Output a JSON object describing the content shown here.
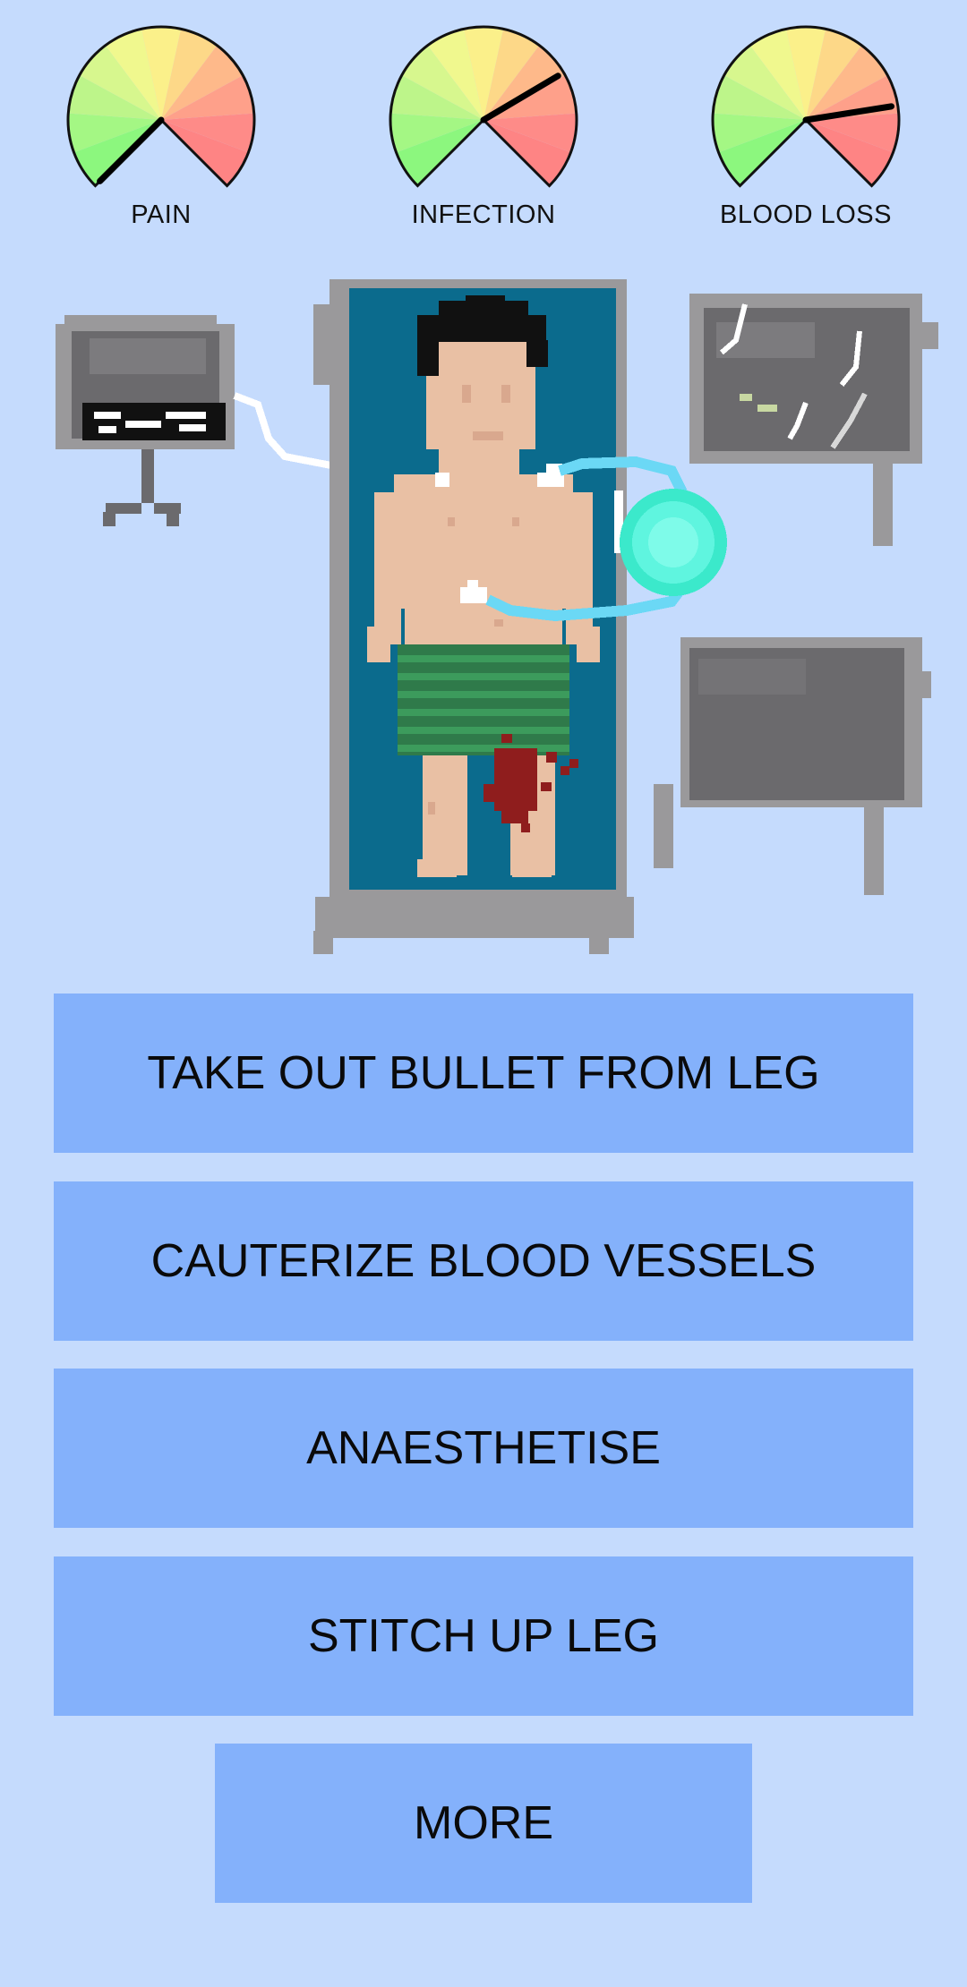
{
  "gauges": [
    {
      "id": "pain",
      "label": "PAIN",
      "level": 0.0
    },
    {
      "id": "infection",
      "label": "INFECTION",
      "level": 0.72
    },
    {
      "id": "blood_loss",
      "label": "BLOOD LOSS",
      "level": 0.8
    }
  ],
  "actions": [
    {
      "id": "take-out-bullet",
      "label": "TAKE OUT BULLET FROM LEG"
    },
    {
      "id": "cauterize",
      "label": "CAUTERIZE BLOOD VESSELS"
    },
    {
      "id": "anaesthetise",
      "label": "ANAESTHETISE"
    },
    {
      "id": "stitch-up",
      "label": "STITCH UP LEG"
    }
  ],
  "more_label": "MORE",
  "colors": {
    "background": "#c5dbfd",
    "button": "#84b1fb",
    "table_blue": "#0b6b8d",
    "equipment_grey": "#6b6a6d",
    "skin": "#e9c0a4",
    "shorts_green": "#2f7a4a",
    "blood": "#8f1d1d",
    "glow_cyan": "#5ff5df"
  },
  "icons": [
    "gauge-icon",
    "monitor-icon",
    "operating-table-icon",
    "patient-icon",
    "glowing-orb-icon"
  ]
}
